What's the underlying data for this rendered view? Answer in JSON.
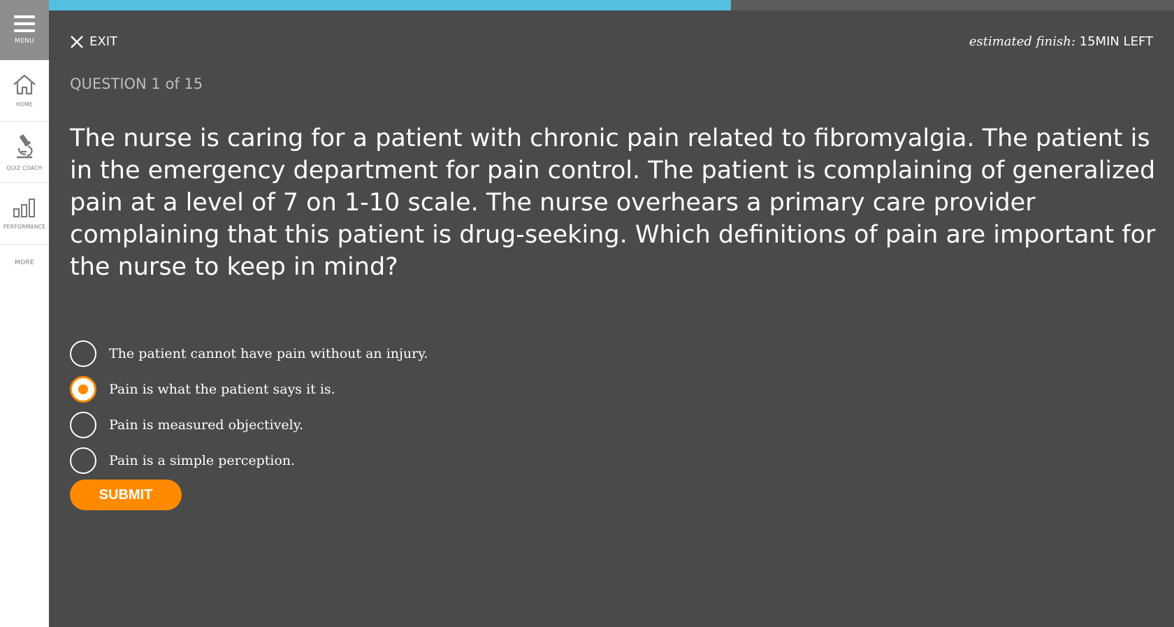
{
  "sidebar": {
    "menu_label": "MENU",
    "items": [
      {
        "label": "HOME",
        "icon": "home-icon"
      },
      {
        "label": "QUIZ COACH",
        "icon": "microscope-icon"
      },
      {
        "label": "PERFORMANCE",
        "icon": "bar-chart-icon"
      },
      {
        "label": "MORE"
      }
    ]
  },
  "progress": {
    "fraction": 0.606,
    "fill_color": "#56bfe0"
  },
  "header": {
    "exit_label": "EXIT",
    "estimate_prefix": "estimated finish:",
    "estimate_value": " 15MIN LEFT"
  },
  "question": {
    "number_label": "QUESTION 1 of 15",
    "text": "The nurse is caring for a patient with chronic pain related to fibromyalgia. The patient is in the emergency department for pain control. The patient is complaining of generalized pain at a level of 7 on 1-10 scale. The nurse overhears a primary care provider complaining that this patient is drug-seeking. Which definitions of pain are important for the nurse to keep in mind?",
    "answers": [
      {
        "text": "The patient cannot have pain without an injury.",
        "selected": false
      },
      {
        "text": "Pain is what the patient says it is.",
        "selected": true
      },
      {
        "text": "Pain is measured objectively.",
        "selected": false
      },
      {
        "text": "Pain is a simple perception.",
        "selected": false
      }
    ]
  },
  "submit_label": "SUBMIT",
  "colors": {
    "accent": "#ff8a00",
    "background": "#4a4a4a",
    "progress": "#56bfe0"
  }
}
